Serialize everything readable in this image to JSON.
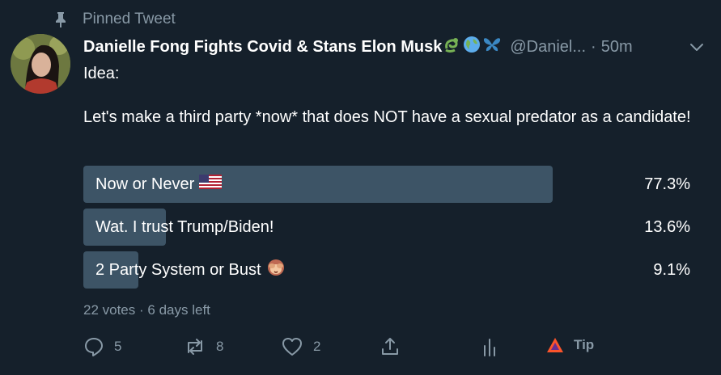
{
  "pinned": {
    "label": "Pinned Tweet",
    "icon": "pin-icon"
  },
  "author": {
    "display_name": "Danielle Fong Fights Covid & Stans Elon Musk",
    "emojis": [
      "dragon-emoji",
      "globe-emoji",
      "butterfly-emoji"
    ],
    "handle": "@Daniel...",
    "separator": "·",
    "time": "50m"
  },
  "tweet": {
    "line1": "Idea:",
    "line2": "Let's make a third party *now* that does NOT have a sexual predator as a candidate!"
  },
  "poll": {
    "options": [
      {
        "label": "Now or Never",
        "emoji": "us-flag-emoji",
        "percent_text": "77.3%",
        "percent": 77.3
      },
      {
        "label": "Wat. I trust Trump/Biden!",
        "emoji": "",
        "percent_text": "13.6%",
        "percent": 13.6
      },
      {
        "label": "2 Party System or Bust",
        "emoji": "see-no-evil-monkey-emoji",
        "percent_text": "9.1%",
        "percent": 9.1
      }
    ],
    "votes": "22 votes",
    "separator": "·",
    "remaining": "6 days left"
  },
  "actions": {
    "reply_count": "5",
    "retweet_count": "8",
    "like_count": "2",
    "tip_label": "Tip"
  },
  "colors": {
    "background": "#15202b",
    "secondary_text": "#8899a6",
    "poll_bar": "#3d5466"
  }
}
